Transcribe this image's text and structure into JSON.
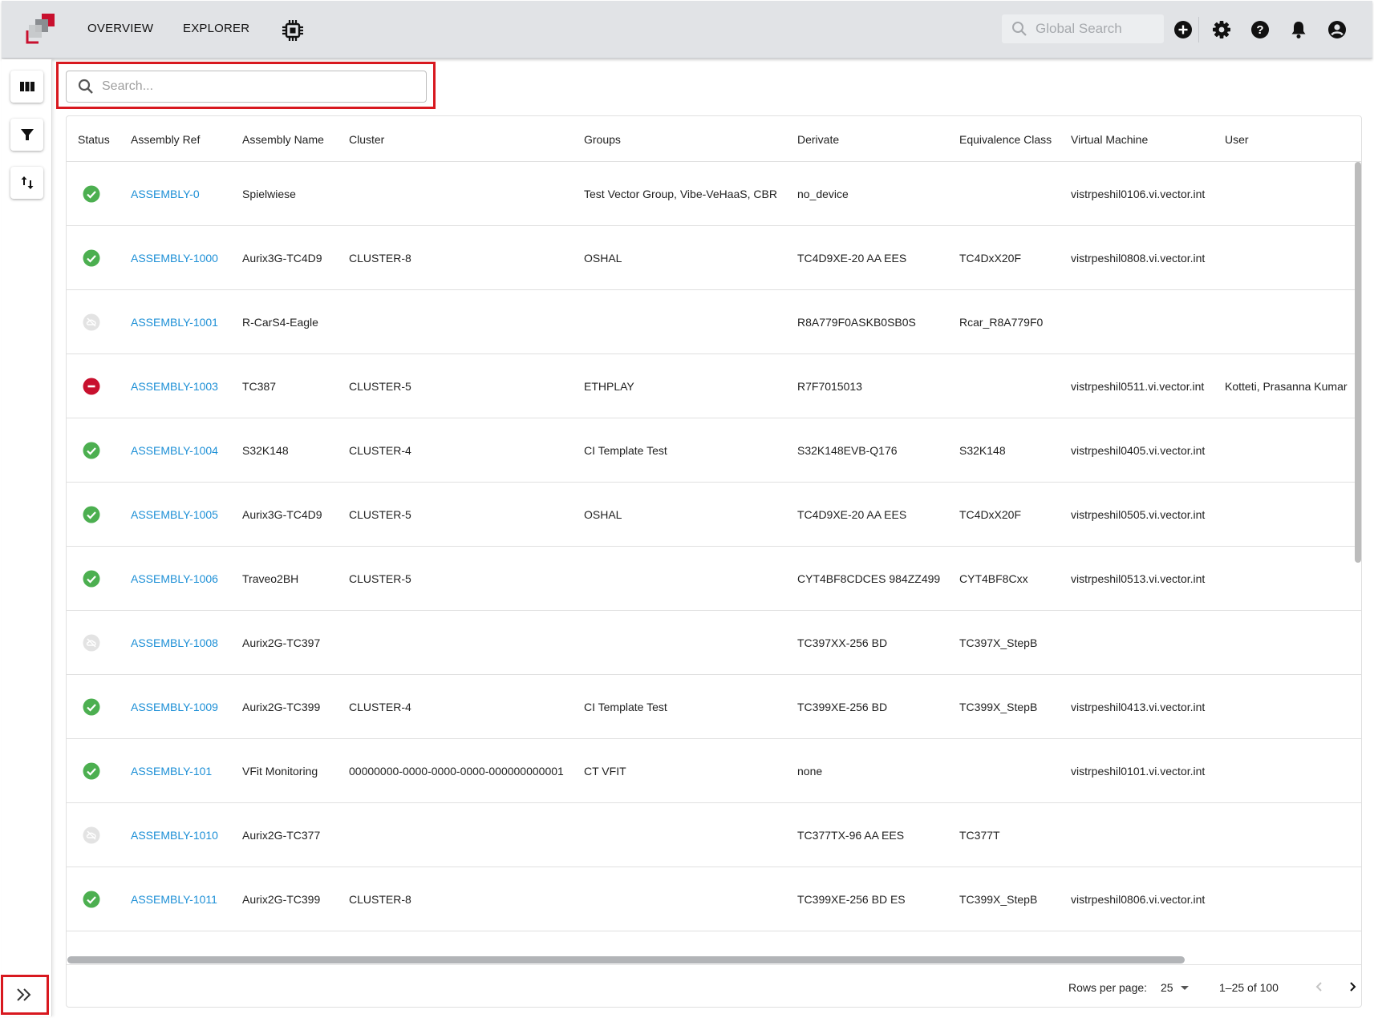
{
  "header": {
    "nav": [
      "OVERVIEW",
      "EXPLORER"
    ],
    "global_search_placeholder": "Global Search",
    "icons": [
      "add-circle-icon",
      "gear-icon",
      "help-icon",
      "bell-icon",
      "account-icon"
    ]
  },
  "colors": {
    "link": "#1c8fd6",
    "ok": "#4caf50",
    "error": "#c8102e",
    "offline": "#d9d9d9",
    "highlight": "#d8181f"
  },
  "rail": {
    "buttons": [
      "columns-icon",
      "filter-icon",
      "sort-icon"
    ],
    "expand": "double-chevron-right-icon"
  },
  "search": {
    "placeholder": "Search..."
  },
  "table": {
    "columns": [
      "Status",
      "Assembly Ref",
      "Assembly Name",
      "Cluster",
      "Groups",
      "Derivate",
      "Equivalence Class",
      "Virtual Machine",
      "User"
    ],
    "rows": [
      {
        "status": "ok",
        "ref": "ASSEMBLY-0",
        "name": "Spielwiese",
        "cluster": "",
        "groups": "Test Vector Group, Vibe-VeHaaS, CBR",
        "derivate": "no_device",
        "eqclass": "",
        "vm": "vistrpeshil0106.vi.vector.int",
        "user": ""
      },
      {
        "status": "ok",
        "ref": "ASSEMBLY-1000",
        "name": "Aurix3G-TC4D9",
        "cluster": "CLUSTER-8",
        "groups": "OSHAL",
        "derivate": "TC4D9XE-20 AA EES",
        "eqclass": "TC4DxX20F",
        "vm": "vistrpeshil0808.vi.vector.int",
        "user": ""
      },
      {
        "status": "offline",
        "ref": "ASSEMBLY-1001",
        "name": "R-CarS4-Eagle",
        "cluster": "",
        "groups": "",
        "derivate": "R8A779F0ASKB0SB0S",
        "eqclass": "Rcar_R8A779F0",
        "vm": "",
        "user": ""
      },
      {
        "status": "error",
        "ref": "ASSEMBLY-1003",
        "name": "TC387",
        "cluster": "CLUSTER-5",
        "groups": "ETHPLAY",
        "derivate": "R7F7015013",
        "eqclass": "",
        "vm": "vistrpeshil0511.vi.vector.int",
        "user": "Kotteti, Prasanna Kumar"
      },
      {
        "status": "ok",
        "ref": "ASSEMBLY-1004",
        "name": "S32K148",
        "cluster": "CLUSTER-4",
        "groups": "CI Template Test",
        "derivate": "S32K148EVB-Q176",
        "eqclass": "S32K148",
        "vm": "vistrpeshil0405.vi.vector.int",
        "user": ""
      },
      {
        "status": "ok",
        "ref": "ASSEMBLY-1005",
        "name": "Aurix3G-TC4D9",
        "cluster": "CLUSTER-5",
        "groups": "OSHAL",
        "derivate": "TC4D9XE-20 AA EES",
        "eqclass": "TC4DxX20F",
        "vm": "vistrpeshil0505.vi.vector.int",
        "user": ""
      },
      {
        "status": "ok",
        "ref": "ASSEMBLY-1006",
        "name": "Traveo2BH",
        "cluster": "CLUSTER-5",
        "groups": "",
        "derivate": "CYT4BF8CDCES 984ZZ499",
        "eqclass": "CYT4BF8Cxx",
        "vm": "vistrpeshil0513.vi.vector.int",
        "user": ""
      },
      {
        "status": "offline",
        "ref": "ASSEMBLY-1008",
        "name": "Aurix2G-TC397",
        "cluster": "",
        "groups": "",
        "derivate": "TC397XX-256 BD",
        "eqclass": "TC397X_StepB",
        "vm": "",
        "user": ""
      },
      {
        "status": "ok",
        "ref": "ASSEMBLY-1009",
        "name": "Aurix2G-TC399",
        "cluster": "CLUSTER-4",
        "groups": "CI Template Test",
        "derivate": "TC399XE-256 BD",
        "eqclass": "TC399X_StepB",
        "vm": "vistrpeshil0413.vi.vector.int",
        "user": ""
      },
      {
        "status": "ok",
        "ref": "ASSEMBLY-101",
        "name": "VFit Monitoring",
        "cluster": "00000000-0000-0000-0000-000000000001",
        "groups": "CT VFIT",
        "derivate": "none",
        "eqclass": "",
        "vm": "vistrpeshil0101.vi.vector.int",
        "user": ""
      },
      {
        "status": "offline",
        "ref": "ASSEMBLY-1010",
        "name": "Aurix2G-TC377",
        "cluster": "",
        "groups": "",
        "derivate": "TC377TX-96 AA EES",
        "eqclass": "TC377T",
        "vm": "",
        "user": ""
      },
      {
        "status": "ok",
        "ref": "ASSEMBLY-1011",
        "name": "Aurix2G-TC399",
        "cluster": "CLUSTER-8",
        "groups": "",
        "derivate": "TC399XE-256 BD ES",
        "eqclass": "TC399X_StepB",
        "vm": "vistrpeshil0806.vi.vector.int",
        "user": ""
      }
    ]
  },
  "footer": {
    "rows_per_page_label": "Rows per page:",
    "rows_per_page": "25",
    "range": "1–25 of 100"
  }
}
